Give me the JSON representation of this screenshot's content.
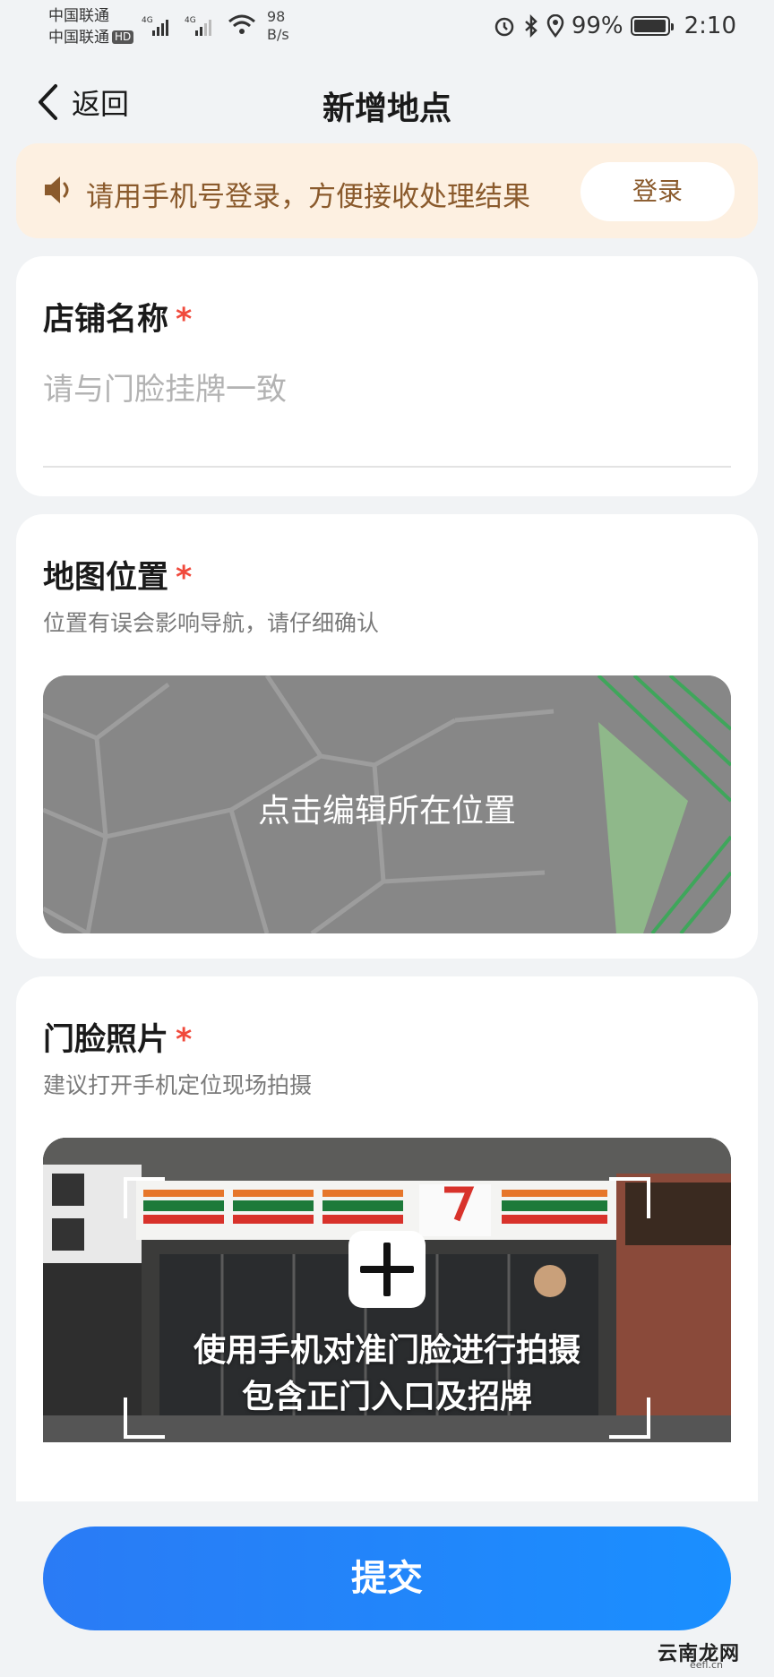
{
  "status_bar": {
    "carrier_1": "中国联通",
    "carrier_2": "中国联通",
    "hd_badge": "HD",
    "network_1": "4G",
    "network_2": "4G",
    "net_speed_value": "98",
    "net_speed_unit": "B/s",
    "battery_percent": "99%",
    "battery_level": 0.99,
    "time": "2:10"
  },
  "nav": {
    "back_label": "返回",
    "title": "新增地点"
  },
  "login_banner": {
    "icon": "speaker-icon",
    "message": "请用手机号登录，方便接收处理结果",
    "button_label": "登录"
  },
  "form": {
    "store_name": {
      "label": "店铺名称",
      "required_mark": "*",
      "value": "",
      "placeholder": "请与门脸挂牌一致"
    },
    "map_location": {
      "label": "地图位置",
      "required_mark": "*",
      "hint": "位置有误会影响导航，请仔细确认",
      "overlay_text": "点击编辑所在位置"
    },
    "storefront_photo": {
      "label": "门脸照片",
      "required_mark": "*",
      "hint": "建议打开手机定位现场拍摄",
      "overlay_line_1": "使用手机对准门脸进行拍摄",
      "overlay_line_2": "包含正门入口及招牌"
    }
  },
  "submit_label": "提交",
  "watermark": {
    "text": "云南龙网",
    "sub": "eefl.cn"
  },
  "colors": {
    "accent_blue": "#1a8fff",
    "banner_bg": "#fdf0e1",
    "banner_text": "#8a5a2c",
    "required_red": "#f04a3c",
    "page_bg": "#f1f3f5"
  }
}
